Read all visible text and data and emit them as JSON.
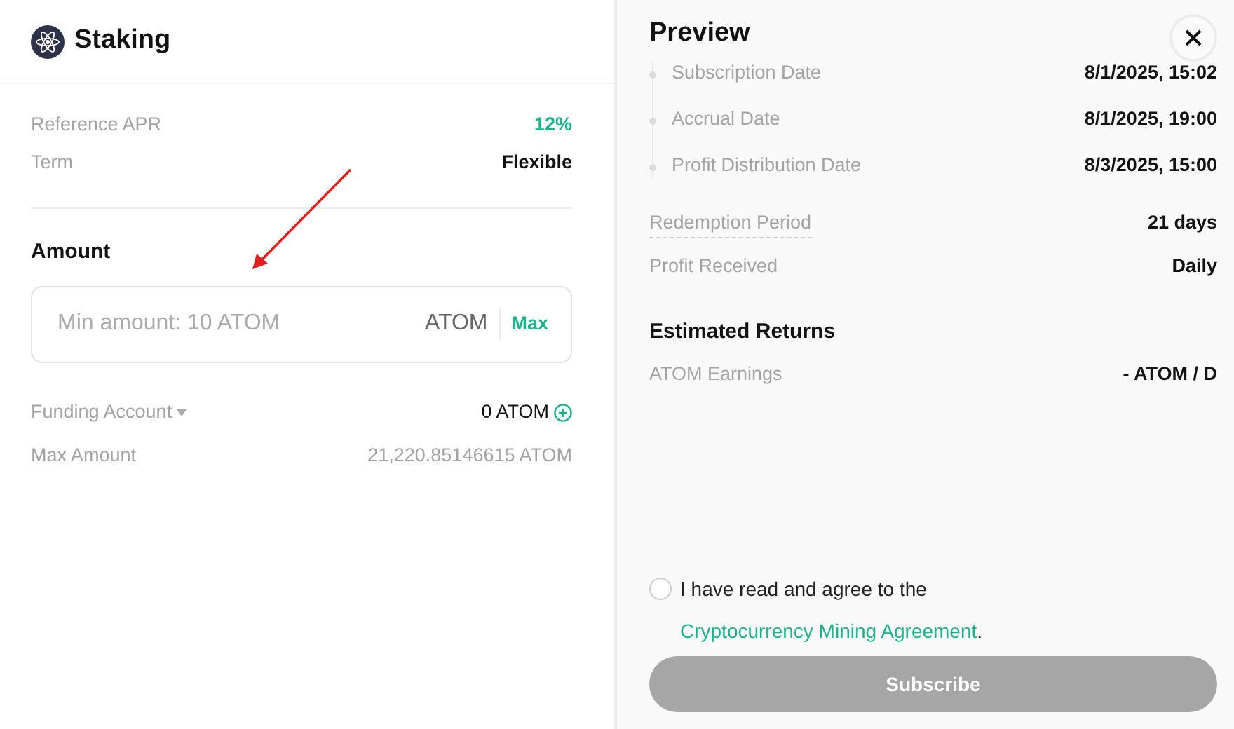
{
  "staking": {
    "title": "Staking",
    "info": [
      {
        "label": "Reference APR",
        "value": "12%",
        "kind": "accent"
      },
      {
        "label": "Term",
        "value": "Flexible",
        "kind": "plain"
      }
    ],
    "amount": {
      "heading": "Amount",
      "placeholder": "Min amount: 10 ATOM",
      "unit": "ATOM",
      "max": "Max"
    },
    "funding": {
      "label": "Funding Account",
      "value": "0 ATOM"
    },
    "max_amount": {
      "label": "Max Amount",
      "value": "21,220.85146615 ATOM"
    }
  },
  "preview": {
    "title": "Preview",
    "timeline": [
      {
        "label": "Subscription Date",
        "value": "8/1/2025, 15:02"
      },
      {
        "label": "Accrual Date",
        "value": "8/1/2025, 19:00"
      },
      {
        "label": "Profit Distribution Date",
        "value": "8/3/2025, 15:00"
      }
    ],
    "details": [
      {
        "label": "Redemption Period",
        "value": "21 days",
        "underlined": true
      },
      {
        "label": "Profit Received",
        "value": "Daily",
        "underlined": false
      }
    ],
    "returns_heading": "Estimated Returns",
    "returns": [
      {
        "label": "ATOM Earnings",
        "value": "- ATOM / D"
      }
    ],
    "agreement": {
      "checked": false,
      "text": "I have read and agree to the ",
      "link": "Cryptocurrency Mining Agreement",
      "end": "."
    },
    "subscribe": {
      "label": "Subscribe",
      "disabled": true
    }
  }
}
